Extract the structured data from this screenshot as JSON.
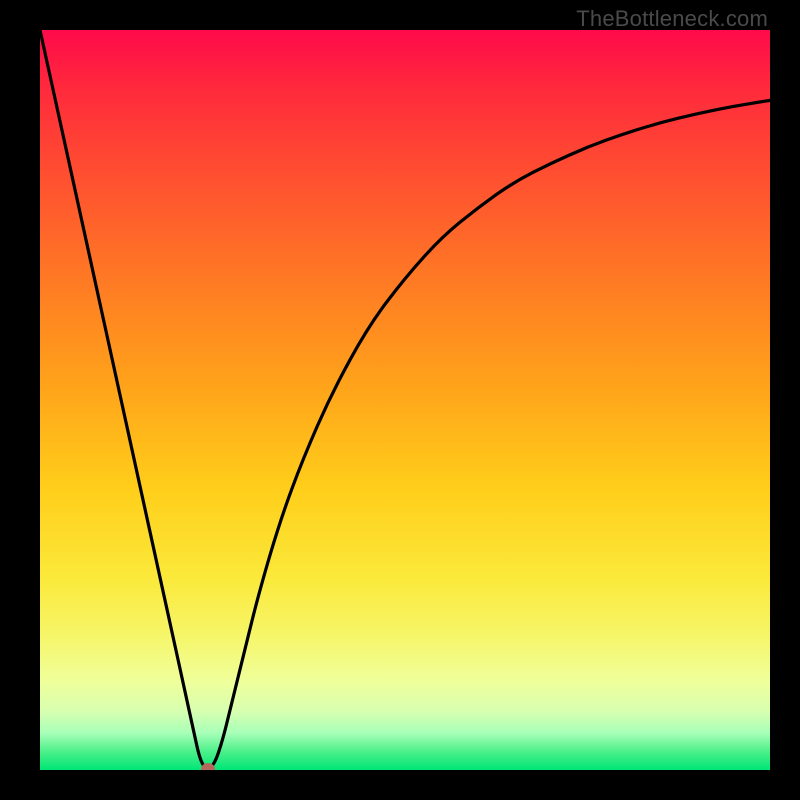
{
  "watermark": "TheBottleneck.com",
  "chart_data": {
    "type": "line",
    "title": "",
    "xlabel": "",
    "ylabel": "",
    "xlim": [
      0,
      100
    ],
    "ylim": [
      0,
      100
    ],
    "x": [
      0,
      2,
      4,
      6,
      8,
      10,
      12,
      14,
      16,
      18,
      20,
      21,
      22,
      23,
      24,
      25,
      26,
      28,
      30,
      33,
      36,
      40,
      45,
      50,
      55,
      60,
      65,
      70,
      75,
      80,
      85,
      90,
      95,
      100
    ],
    "y": [
      100,
      91,
      82,
      73,
      64,
      55,
      46,
      37,
      28,
      19,
      10,
      5.5,
      1,
      0,
      1,
      4,
      8,
      16,
      24,
      34,
      42,
      51,
      60,
      66.5,
      72,
      76,
      79.5,
      82,
      84.2,
      86,
      87.5,
      88.7,
      89.7,
      90.5
    ],
    "marker": {
      "x": 23,
      "y": 0
    },
    "background_gradient": {
      "direction": "vertical",
      "stops": [
        {
          "pos": 0.0,
          "color": "#ff0a4a"
        },
        {
          "pos": 0.5,
          "color": "#ffce1a"
        },
        {
          "pos": 0.85,
          "color": "#f6f66a"
        },
        {
          "pos": 1.0,
          "color": "#00e676"
        }
      ]
    }
  }
}
